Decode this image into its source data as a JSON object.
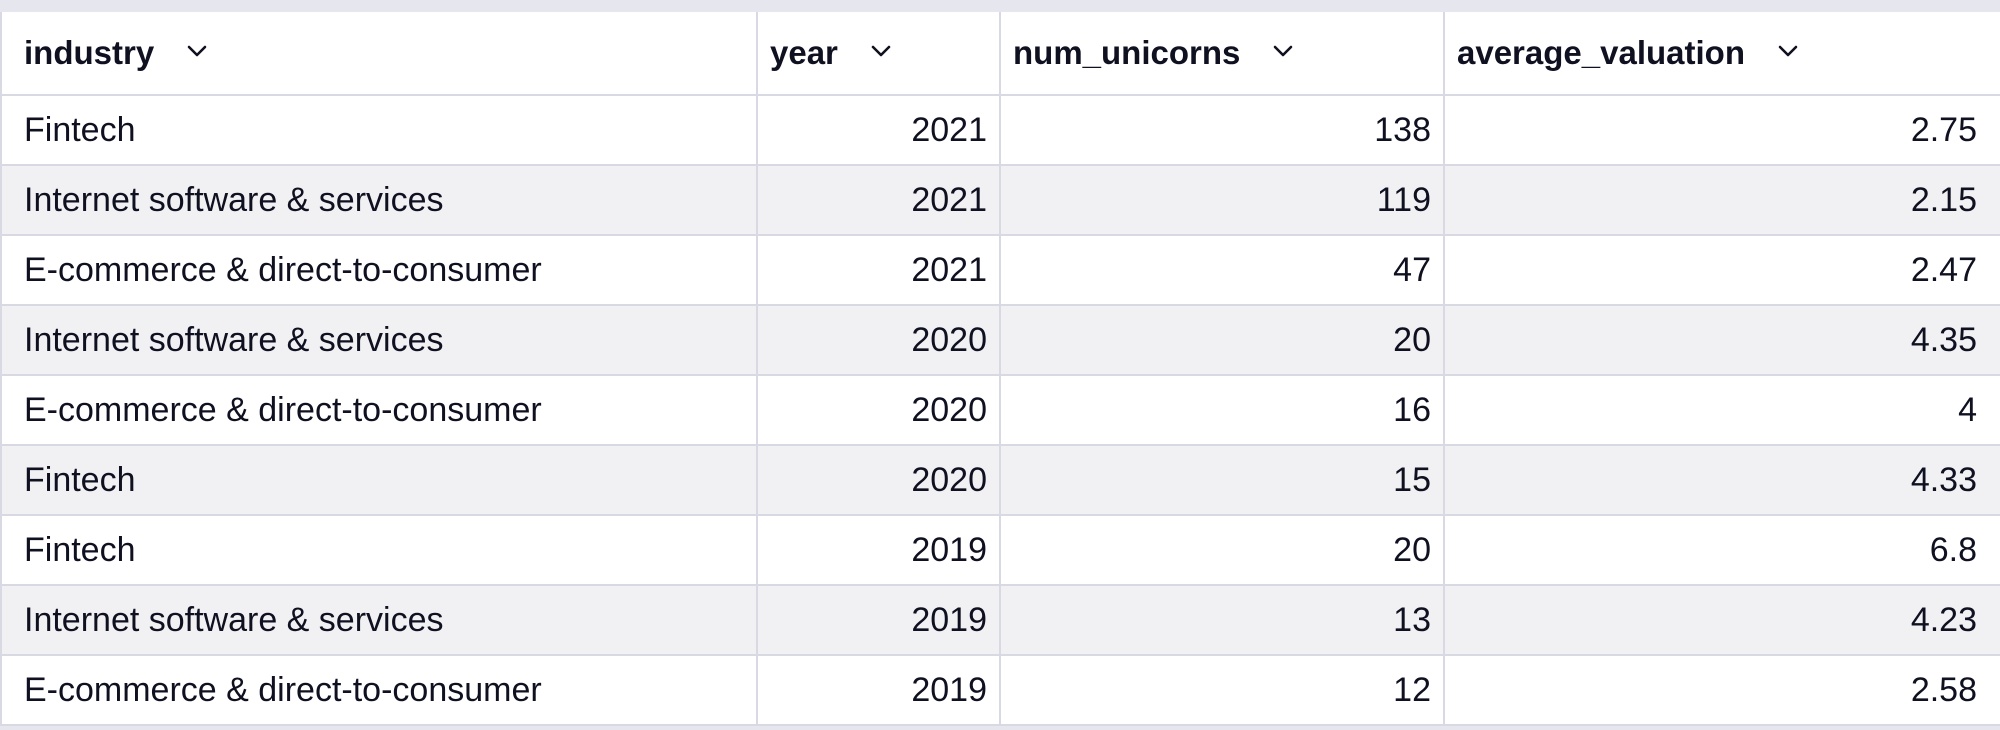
{
  "table": {
    "columns": [
      {
        "label": "industry",
        "icon": "chevron-down-icon"
      },
      {
        "label": "year",
        "icon": "chevron-down-icon"
      },
      {
        "label": "num_unicorns",
        "icon": "chevron-down-icon"
      },
      {
        "label": "average_valuation",
        "icon": "chevron-down-icon"
      }
    ],
    "rows": [
      {
        "industry": "Fintech",
        "year": "2021",
        "num_unicorns": "138",
        "average_valuation": "2.75"
      },
      {
        "industry": "Internet software & services",
        "year": "2021",
        "num_unicorns": "119",
        "average_valuation": "2.15"
      },
      {
        "industry": "E-commerce & direct-to-consumer",
        "year": "2021",
        "num_unicorns": "47",
        "average_valuation": "2.47"
      },
      {
        "industry": "Internet software & services",
        "year": "2020",
        "num_unicorns": "20",
        "average_valuation": "4.35"
      },
      {
        "industry": "E-commerce & direct-to-consumer",
        "year": "2020",
        "num_unicorns": "16",
        "average_valuation": "4"
      },
      {
        "industry": "Fintech",
        "year": "2020",
        "num_unicorns": "15",
        "average_valuation": "4.33"
      },
      {
        "industry": "Fintech",
        "year": "2019",
        "num_unicorns": "20",
        "average_valuation": "6.8"
      },
      {
        "industry": "Internet software & services",
        "year": "2019",
        "num_unicorns": "13",
        "average_valuation": "4.23"
      },
      {
        "industry": "E-commerce & direct-to-consumer",
        "year": "2019",
        "num_unicorns": "12",
        "average_valuation": "2.58"
      }
    ]
  },
  "colors": {
    "border": "#d9d9e3",
    "stripe": "#f1f1f4",
    "text": "#0f1020"
  }
}
